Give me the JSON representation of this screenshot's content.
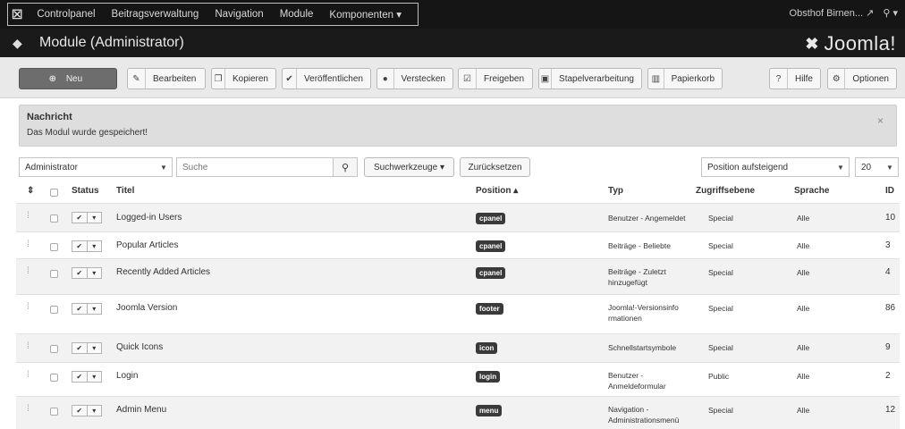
{
  "topbar": {
    "logo": "☒",
    "menu": [
      "Controlpanel",
      "Beitragsverwaltung",
      "Navigation",
      "Module",
      "Komponenten ▾"
    ],
    "site": "Obsthof Birnen...",
    "site_icon": "external-link-icon",
    "user": "⚲ ▾"
  },
  "header": {
    "icon": "cube-icon",
    "title": "Module (Administrator)",
    "brand": "Joomla!"
  },
  "toolbar": {
    "new": "Neu",
    "edit": "Bearbeiten",
    "copy": "Kopieren",
    "publish": "Veröffentlichen",
    "unpublish": "Verstecken",
    "checkin": "Freigeben",
    "batch": "Stapelverarbeitung",
    "trash": "Papierkorb",
    "help": "Hilfe",
    "options": "Optionen"
  },
  "message": {
    "title": "Nachricht",
    "text": "Das Modul wurde gespeichert!",
    "close": "×"
  },
  "filters": {
    "client": "Administrator",
    "search_placeholder": "Suche",
    "search_tools": "Suchwerkzeuge ▾",
    "reset": "Zurücksetzen",
    "ordering": "Position aufsteigend",
    "limit": "20"
  },
  "table": {
    "headers": {
      "sort": "⇕",
      "status": "Status",
      "title": "Titel",
      "position": "Position ▴",
      "type": "Typ",
      "access": "Zugriffsebene",
      "language": "Sprache",
      "id": "ID"
    },
    "rows": [
      {
        "title": "Logged-in Users",
        "position": "cpanel",
        "type": "Benutzer - Angemeldet",
        "access": "Special",
        "language": "Alle",
        "id": "10"
      },
      {
        "title": "Popular Articles",
        "position": "cpanel",
        "type": "Beiträge - Beliebte",
        "access": "Special",
        "language": "Alle",
        "id": "3"
      },
      {
        "title": "Recently Added Articles",
        "position": "cpanel",
        "type": "Beiträge - Zuletzt hinzugefügt",
        "access": "Special",
        "language": "Alle",
        "id": "4"
      },
      {
        "title": "Joomla Version",
        "position": "footer",
        "type": "Joomla!-Versionsinformationen",
        "access": "Special",
        "language": "Alle",
        "id": "86"
      },
      {
        "title": "Quick Icons",
        "position": "icon",
        "type": "Schnellstartsymbole",
        "access": "Special",
        "language": "Alle",
        "id": "9"
      },
      {
        "title": "Login",
        "position": "login",
        "type": "Benutzer - Anmeldeformular",
        "access": "Public",
        "language": "Alle",
        "id": "2"
      },
      {
        "title": "Admin Menu",
        "position": "menu",
        "type": "Navigation - Administrationsmenü",
        "access": "Special",
        "language": "Alle",
        "id": "12"
      }
    ]
  }
}
